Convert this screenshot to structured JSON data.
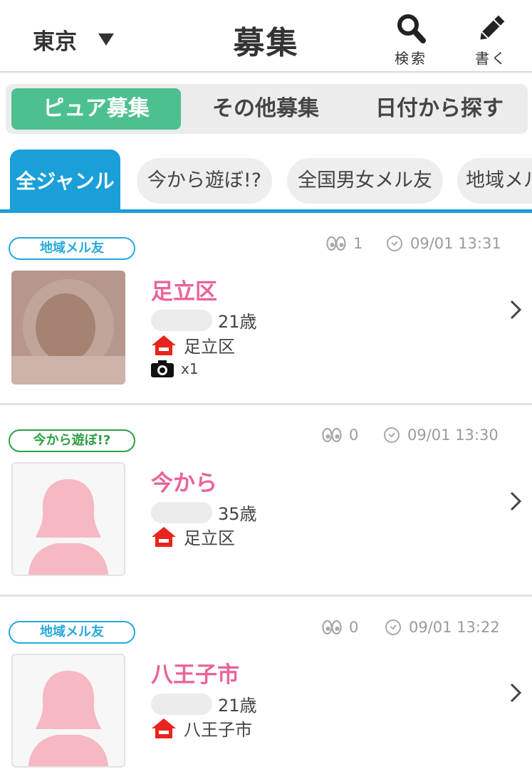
{
  "header": {
    "region": "東京",
    "title": "募集",
    "search_label": "検索",
    "write_label": "書く"
  },
  "segment": [
    "ピュア募集",
    "その他募集",
    "日付から探す"
  ],
  "genres": [
    "全ジャンル",
    "今から遊ぼ!?",
    "全国男女メル友",
    "地域メル友"
  ],
  "posts": [
    {
      "badge": "地域メル友",
      "badge_color": "#26a9dc",
      "views": "1",
      "time": "09/01 13:31",
      "title": "足立区",
      "age": "21歳",
      "area": "足立区",
      "photo_count": "x1",
      "avatar": "photo"
    },
    {
      "badge": "今から遊ぼ!?",
      "badge_color": "#2c9f44",
      "views": "0",
      "time": "09/01 13:30",
      "title": "今から",
      "age": "35歳",
      "area": "足立区",
      "avatar": "silhouette"
    },
    {
      "badge": "地域メル友",
      "badge_color": "#26a9dc",
      "views": "0",
      "time": "09/01 13:22",
      "title": "八王子市",
      "age": "21歳",
      "area": "八王子市",
      "avatar": "silhouette"
    }
  ],
  "colors": {
    "accent_green": "#4dc08f",
    "accent_blue": "#1a9fd8",
    "title_pink": "#e8649a",
    "home_red": "#e8241c"
  },
  "icons": {
    "search": "search-icon",
    "write": "pencil-icon",
    "views": "eyes-icon",
    "time": "clock-icon",
    "home": "home-icon",
    "camera": "camera-icon",
    "next": "chevron-right-icon"
  }
}
